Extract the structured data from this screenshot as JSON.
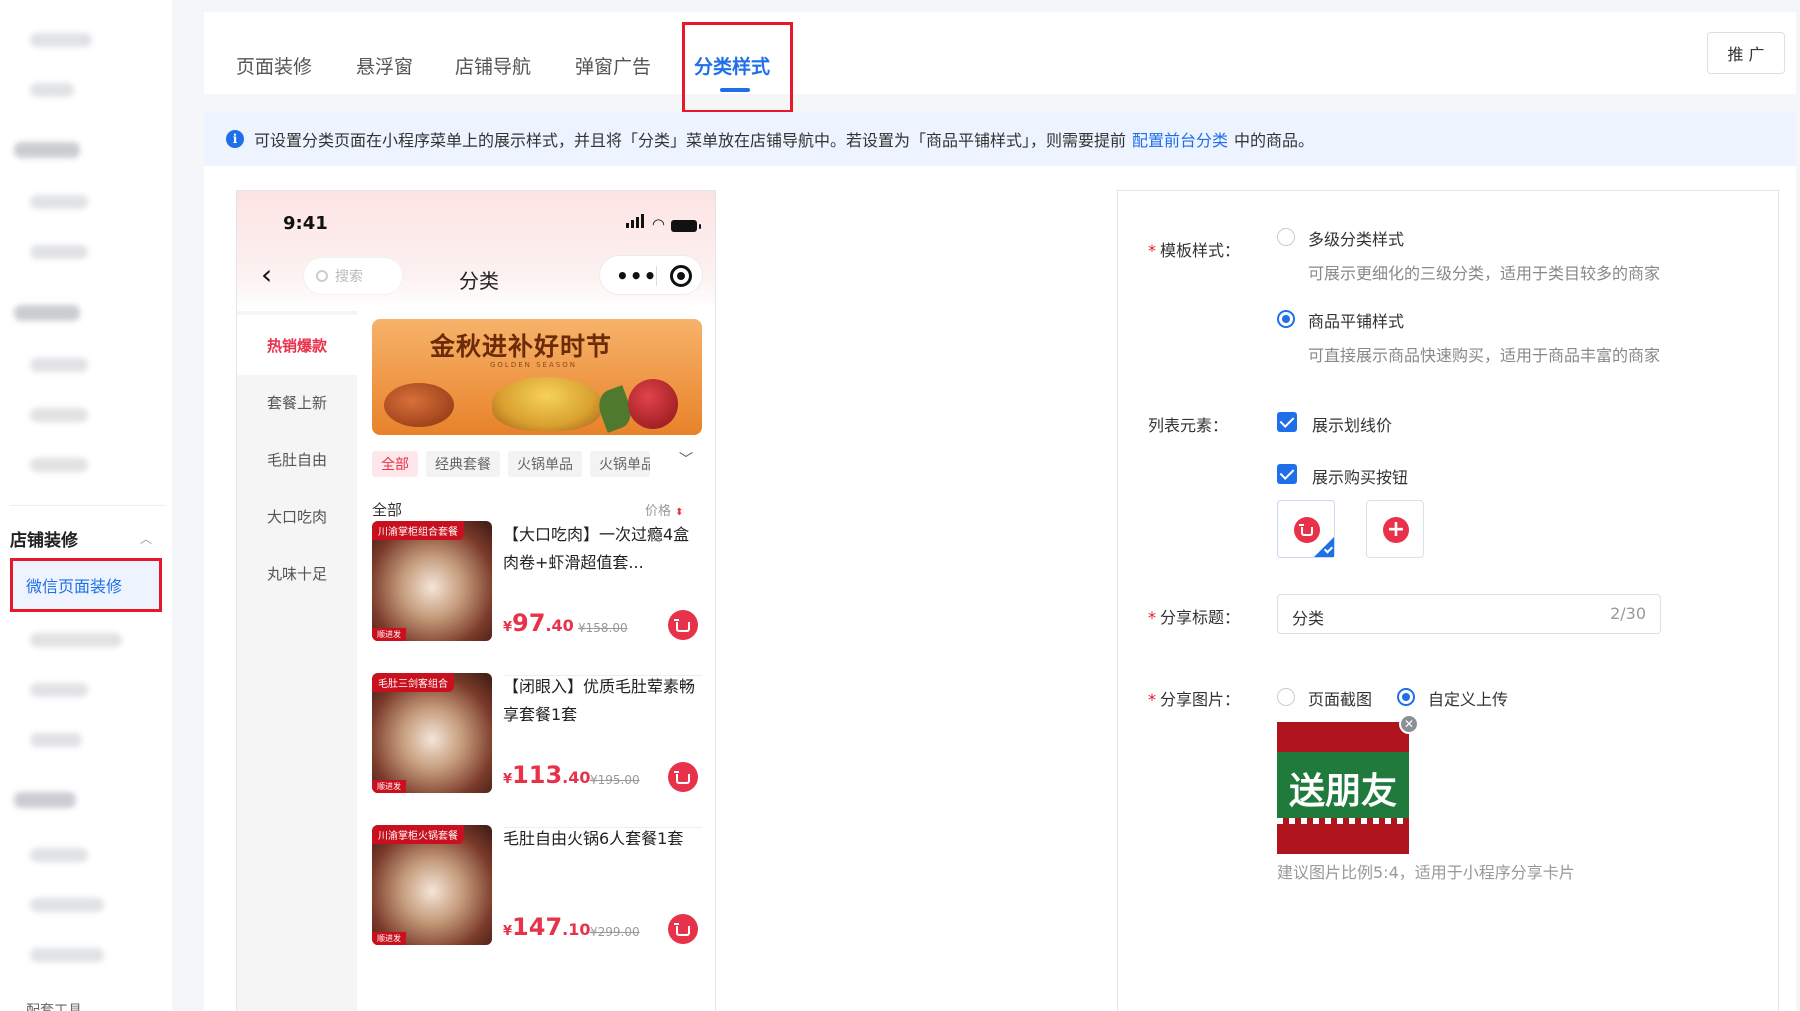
{
  "tabs": [
    {
      "label": "页面装修"
    },
    {
      "label": "悬浮窗"
    },
    {
      "label": "店铺导航"
    },
    {
      "label": "弹窗广告"
    },
    {
      "label": "分类样式",
      "active": true
    }
  ],
  "promo_button": "推 广",
  "sidebar": {
    "group_title": "店铺装修",
    "active_item": "微信页面装修",
    "bottom_item": "配套工具"
  },
  "notice": {
    "text_before": "可设置分类页面在小程序菜单上的展示样式，并且将「分类」菜单放在店铺导航中。若设置为「商品平铺样式」，则需要提前",
    "link": "配置前台分类",
    "text_after": "中的商品。"
  },
  "phone": {
    "time": "9:41",
    "search_placeholder": "搜索",
    "title": "分类",
    "categories": [
      "热销爆款",
      "套餐上新",
      "毛肚自由",
      "大口吃肉",
      "丸味十足"
    ],
    "banner": {
      "title": "金秋进补好时节",
      "subtitle": "GOLDEN SEASON"
    },
    "chips": [
      "全部",
      "经典套餐",
      "火锅单品",
      "火锅单品"
    ],
    "section_label": "全部",
    "sort_label": "价格",
    "products": [
      {
        "tag": "川渝掌柜组合套餐",
        "name": "【大口吃肉】一次过瘾4盒肉卷+虾滑超值套...",
        "price_int": "97",
        "price_dec": ".40",
        "original": "¥158.00",
        "badge": "顺进发"
      },
      {
        "tag": "毛肚三剑客组合",
        "name": "【闭眼入】优质毛肚荤素畅享套餐1套",
        "price_int": "113",
        "price_dec": ".40",
        "original": "¥195.00",
        "badge": "顺进发"
      },
      {
        "tag": "川渝掌柜火锅套餐",
        "name": "毛肚自由火锅6人套餐1套",
        "price_int": "147",
        "price_dec": ".10",
        "original": "¥299.00",
        "badge": "顺进发"
      }
    ]
  },
  "settings": {
    "template_label": "模板样式：",
    "template_options": [
      {
        "label": "多级分类样式",
        "desc": "可展示更细化的三级分类，适用于类目较多的商家",
        "selected": false
      },
      {
        "label": "商品平铺样式",
        "desc": "可直接展示商品快速购买，适用于商品丰富的商家",
        "selected": true
      }
    ],
    "list_label": "列表元素：",
    "list_options": [
      {
        "label": "展示划线价",
        "checked": true
      },
      {
        "label": "展示购买按钮",
        "checked": true
      }
    ],
    "share_title_label": "分享标题：",
    "share_title_value": "分类",
    "share_title_count": "2/30",
    "share_image_label": "分享图片：",
    "share_image_options": [
      {
        "label": "页面截图",
        "selected": false
      },
      {
        "label": "自定义上传",
        "selected": true
      }
    ],
    "share_image_text": "送朋友",
    "share_image_hint": "建议图片比例5:4，适用于小程序分享卡片"
  },
  "colors": {
    "accent": "#1f6fe8",
    "price_red": "#e8324a",
    "highlight_border": "#e8182a"
  }
}
